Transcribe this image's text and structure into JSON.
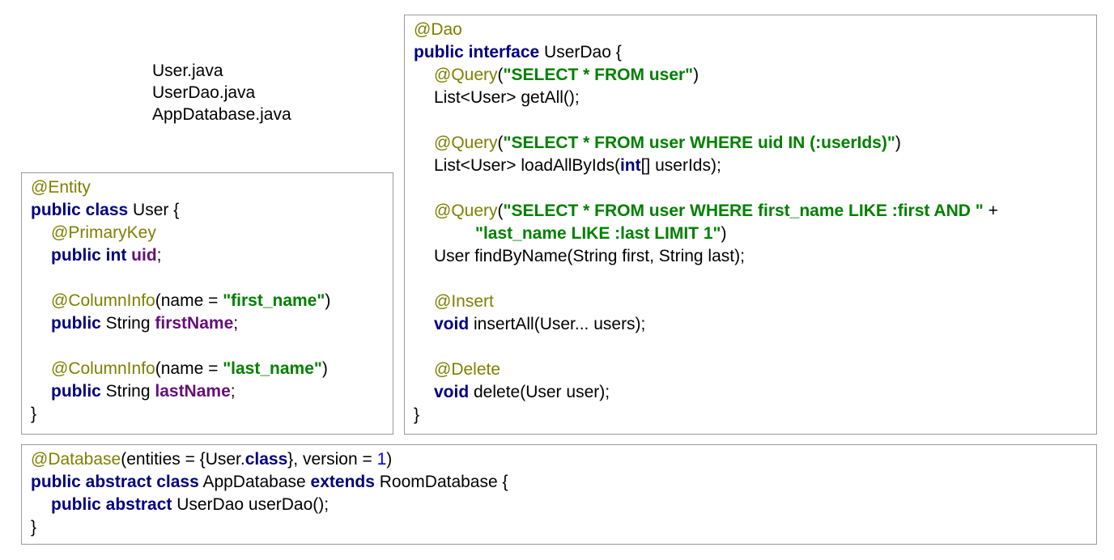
{
  "files": [
    "User.java",
    "UserDao.java",
    "AppDatabase.java"
  ],
  "colors": {
    "annotation": "#7f7f00",
    "keyword": "#000080",
    "string": "#008000",
    "field": "#660e7a",
    "number": "#0000ff",
    "border": "#9a9a9a"
  },
  "user_code": {
    "ann_entity": "@Entity",
    "kw_public_class": "public class",
    "txt_user_open": " User {",
    "ann_primarykey": "@PrimaryKey",
    "kw_public_int": "public int",
    "fld_uid": "uid",
    "semi": ";",
    "ann_columninfo": "@ColumnInfo",
    "txt_name_eq": "(name = ",
    "str_first_name": "\"first_name\"",
    "close_paren": ")",
    "kw_public": "public",
    "txt_string": " String ",
    "fld_firstname": "firstName",
    "str_last_name": "\"last_name\"",
    "fld_lastname": "lastName",
    "close_brace": "}"
  },
  "dao_code": {
    "ann_dao": "@Dao",
    "kw_public_interface": "public interface",
    "txt_userdao_open": " UserDao {",
    "ann_query": "@Query",
    "open_paren": "(",
    "str_q1": "\"SELECT * FROM user\"",
    "close_paren": ")",
    "txt_getall": "List<User> getAll();",
    "str_q2": "\"SELECT * FROM user WHERE uid IN (:userIds)\"",
    "txt_loadall_pre": "List<User> loadAllByIds(",
    "kw_int": "int",
    "txt_loadall_post": "[] userIds);",
    "str_q3a": "\"SELECT * FROM user WHERE first_name LIKE :first AND \"",
    "txt_plus": " +",
    "str_q3b": "\"last_name LIKE :last LIMIT 1\"",
    "txt_findbyname": "User findByName(String first, String last);",
    "ann_insert": "@Insert",
    "kw_void": "void",
    "txt_insertall": " insertAll(User... users);",
    "ann_delete": "@Delete",
    "txt_delete": " delete(User user);",
    "close_brace": "}"
  },
  "db_code": {
    "ann_database": "@Database",
    "txt_entities_pre": "(entities = {User.",
    "kw_class": "class",
    "txt_version": "}, version = ",
    "num_version": "1",
    "close_paren": ")",
    "kw_public_abstract_class": "public abstract class",
    "txt_appdatabase": " AppDatabase ",
    "kw_extends": "extends",
    "txt_roomdatabase_open": " RoomDatabase {",
    "kw_public_abstract": "public abstract",
    "txt_userdao_method": " UserDao userDao();",
    "close_brace": "}"
  }
}
